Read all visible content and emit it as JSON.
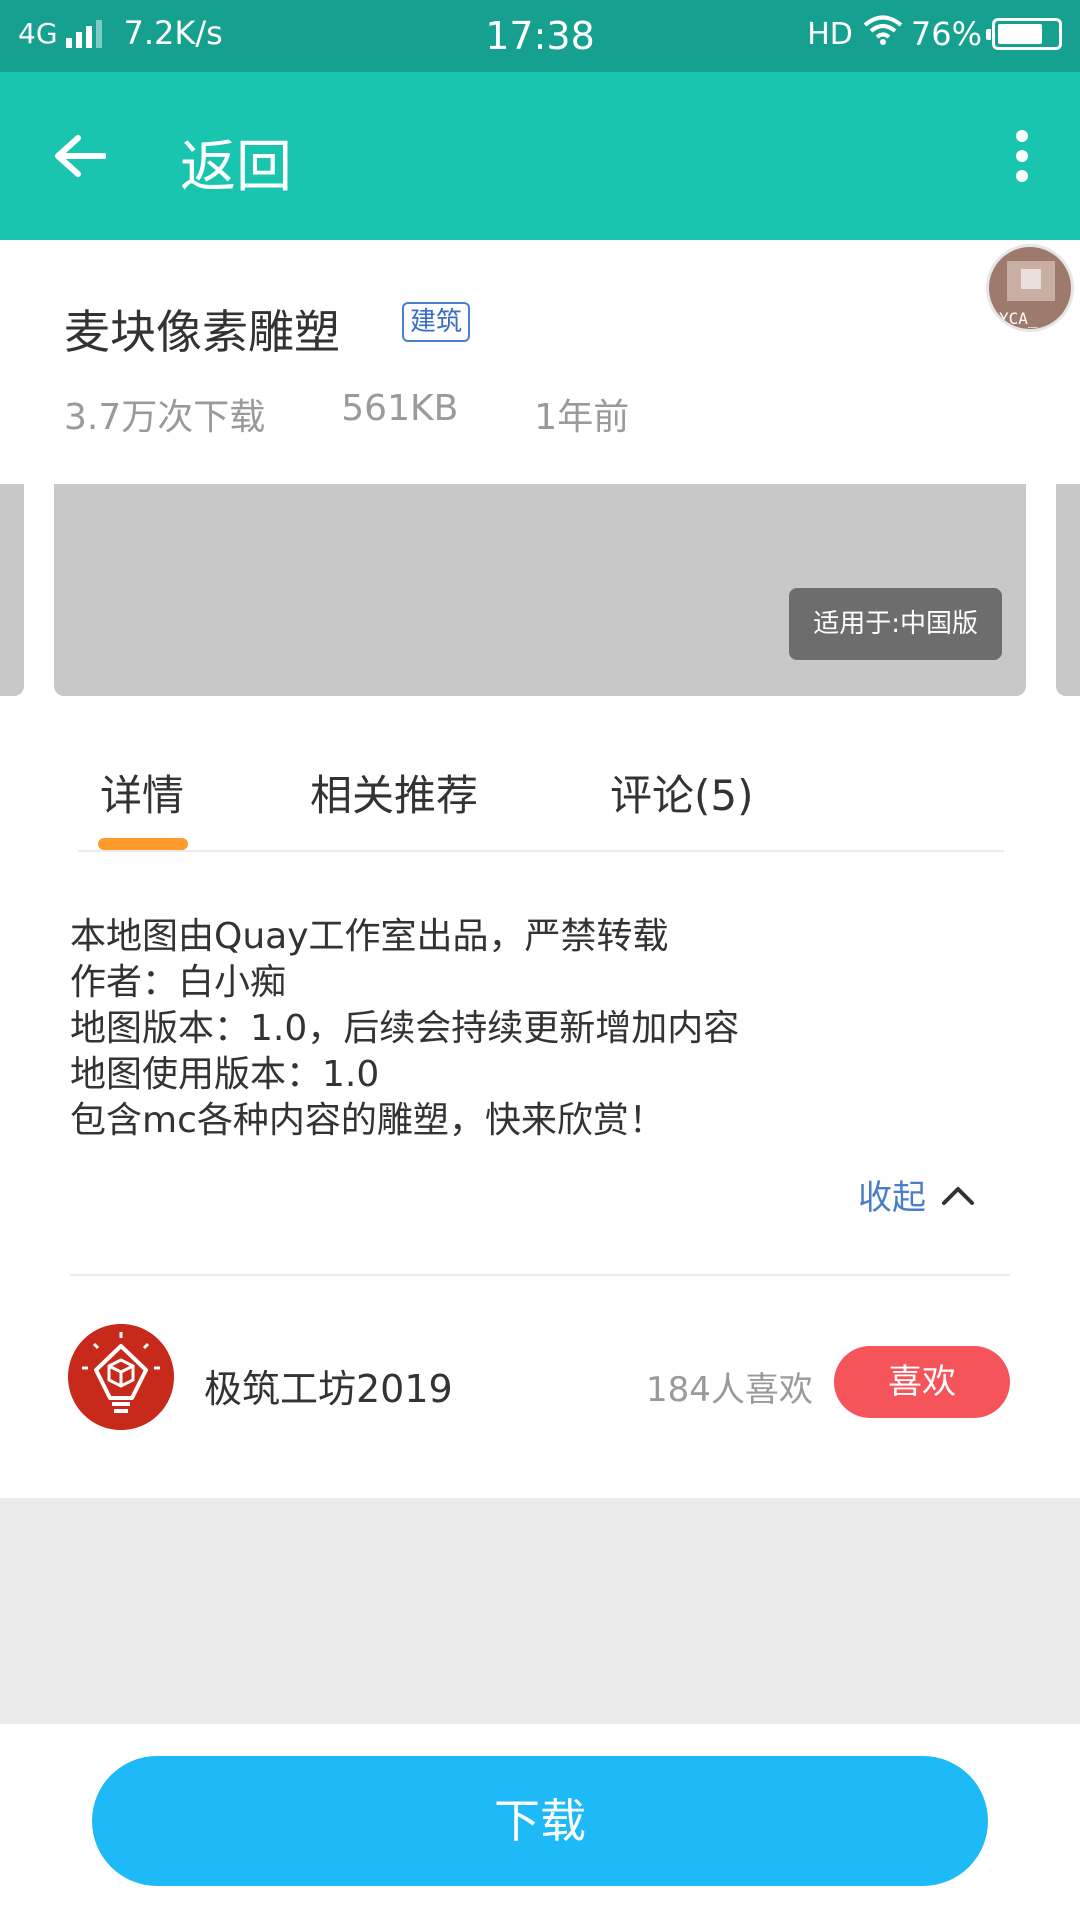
{
  "status_bar": {
    "network": "4G",
    "speed": "7.2K/s",
    "time": "17:38",
    "hd": "HD",
    "battery": "76%",
    "battery_level": 0.76
  },
  "app_bar": {
    "back_icon": "arrow-left-icon",
    "title": "返回",
    "more_icon": "more-vertical-icon"
  },
  "map": {
    "title": "麦块像素雕塑",
    "tag": "建筑",
    "downloads": "3.7万次下载",
    "size": "561KB",
    "updated": "1年前",
    "avatar_caption": "YCA_"
  },
  "banner": {
    "badge": "适用于:中国版"
  },
  "tabs": [
    {
      "label": "详情",
      "active": true
    },
    {
      "label": "相关推荐",
      "active": false
    },
    {
      "label": "评论(5)",
      "active": false
    }
  ],
  "details": {
    "lines": [
      "本地图由Quay工作室出品，严禁转载",
      "作者：白小痴",
      "地图版本：1.0，后续会持续更新增加内容",
      "地图使用版本：1.0",
      "包含mc各种内容的雕塑，快来欣赏！"
    ],
    "collapse_label": "收起"
  },
  "author": {
    "name": "极筑工坊2019",
    "likes": "184人喜欢",
    "like_button": "喜欢"
  },
  "download": {
    "label": "下载"
  },
  "colors": {
    "status_bar": "#16a08f",
    "app_bar": "#1ac5b0",
    "tab_indicator": "#ff9a2d",
    "tag": "#3b6fc5",
    "like_button": "#f5555a",
    "download_button": "#1ebaf8"
  }
}
